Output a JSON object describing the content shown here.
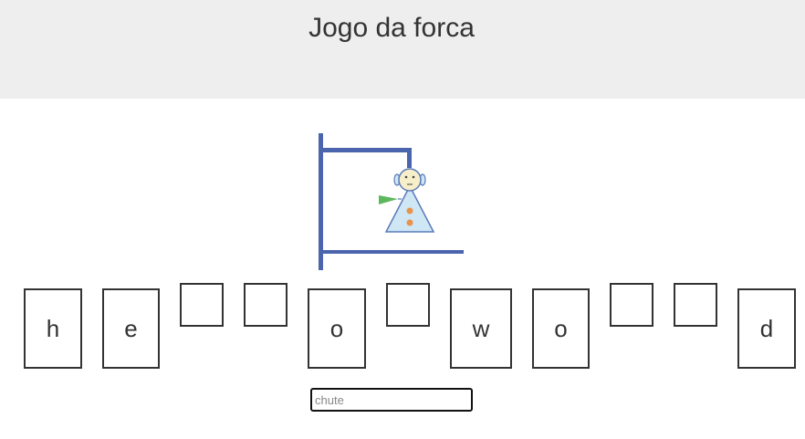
{
  "header": {
    "title": "Jogo da forca"
  },
  "hangman": {
    "image": "hangman-gallows-with-figure",
    "colors": {
      "pole": "#4a64ad",
      "figure_fill": "#cfe6f5",
      "flag": "#5cb85c",
      "buttons": "#e8924a"
    }
  },
  "word": {
    "slots": [
      {
        "letter": "h",
        "revealed": true
      },
      {
        "letter": "e",
        "revealed": true
      },
      {
        "letter": "",
        "revealed": false
      },
      {
        "letter": "",
        "revealed": false
      },
      {
        "letter": "o",
        "revealed": true
      },
      {
        "letter": "",
        "revealed": false
      },
      {
        "letter": "w",
        "revealed": true
      },
      {
        "letter": "o",
        "revealed": true
      },
      {
        "letter": "",
        "revealed": false
      },
      {
        "letter": "",
        "revealed": false
      },
      {
        "letter": "d",
        "revealed": true
      }
    ]
  },
  "guess": {
    "placeholder": "chute",
    "value": ""
  }
}
